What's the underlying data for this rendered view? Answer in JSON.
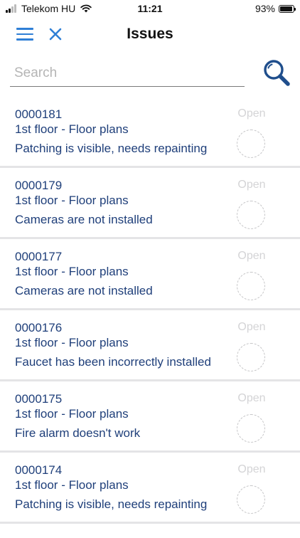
{
  "status_bar": {
    "carrier": "Telekom HU",
    "time": "11:21",
    "battery": "93%",
    "battery_level": 0.93,
    "signal_icon": "cellular-signal-icon",
    "wifi_icon": "wifi-icon",
    "battery_icon": "battery-icon"
  },
  "nav": {
    "title": "Issues",
    "menu_icon": "hamburger-menu-icon",
    "close_icon": "close-icon",
    "accent_color": "#2f7fd6"
  },
  "search": {
    "placeholder": "Search",
    "value": "",
    "icon": "search-icon",
    "icon_color": "#1f4e8c"
  },
  "issues": [
    {
      "id": "0000181",
      "location": "1st floor - Floor plans",
      "description": "Patching is visible, needs repainting",
      "status": "Open"
    },
    {
      "id": "0000179",
      "location": "1st floor - Floor plans",
      "description": "Cameras are not installed",
      "status": "Open"
    },
    {
      "id": "0000177",
      "location": "1st floor - Floor plans",
      "description": "Cameras are not installed",
      "status": "Open"
    },
    {
      "id": "0000176",
      "location": "1st floor - Floor plans",
      "description": "Faucet has been incorrectly installed",
      "status": "Open"
    },
    {
      "id": "0000175",
      "location": "1st floor - Floor plans",
      "description": "Fire alarm doesn't work",
      "status": "Open"
    },
    {
      "id": "0000174",
      "location": "1st floor - Floor plans",
      "description": "Patching is visible, needs repainting",
      "status": "Open"
    }
  ],
  "colors": {
    "text_primary": "#1f3f7a",
    "status_text": "#d4d4d6",
    "background": "#f2f2f4"
  }
}
